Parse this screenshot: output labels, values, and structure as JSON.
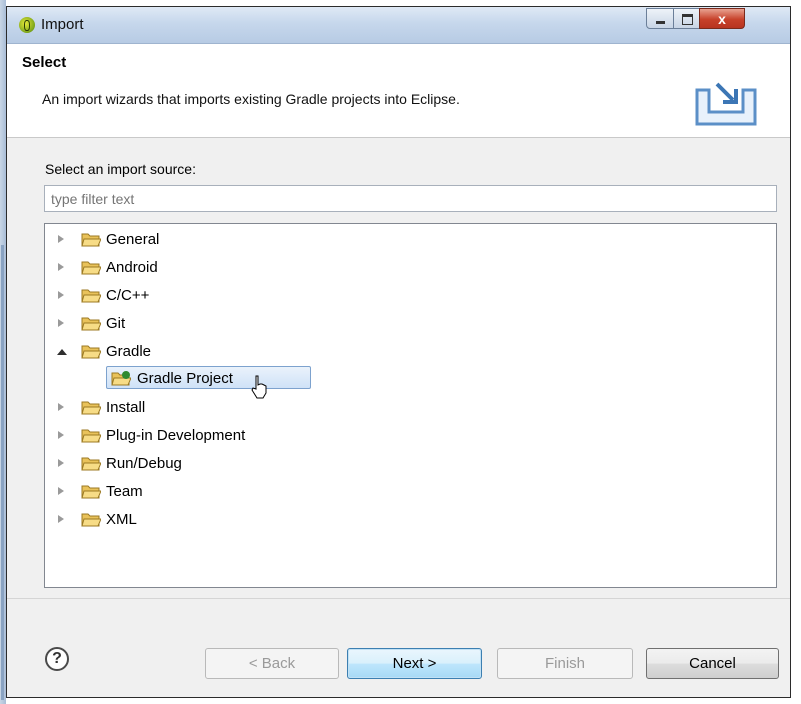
{
  "window": {
    "title": "Import"
  },
  "header": {
    "title": "Select",
    "description": "An import wizards that imports existing Gradle projects into Eclipse."
  },
  "source": {
    "label": "Select an import source:",
    "filter_placeholder": "type filter text"
  },
  "tree": [
    {
      "label": "General",
      "expanded": false
    },
    {
      "label": "Android",
      "expanded": false
    },
    {
      "label": "C/C++",
      "expanded": false
    },
    {
      "label": "Git",
      "expanded": false
    },
    {
      "label": "Gradle",
      "expanded": true
    },
    {
      "label": "Gradle Project",
      "child": true,
      "selected": true
    },
    {
      "label": "Install",
      "expanded": false
    },
    {
      "label": "Plug-in Development",
      "expanded": false
    },
    {
      "label": "Run/Debug",
      "expanded": false
    },
    {
      "label": "Team",
      "expanded": false
    },
    {
      "label": "XML",
      "expanded": false
    }
  ],
  "buttons": {
    "help": "?",
    "back": "< Back",
    "next": "Next >",
    "finish": "Finish",
    "cancel": "Cancel"
  },
  "icons": {
    "window": "eclipse-icon",
    "header": "import-tray-icon",
    "folder": "folder-icon",
    "gradle_project": "gradle-project-icon",
    "help": "help-icon"
  },
  "colors": {
    "selection": "#cfe2f7",
    "default_button": "#a7d9f5"
  }
}
